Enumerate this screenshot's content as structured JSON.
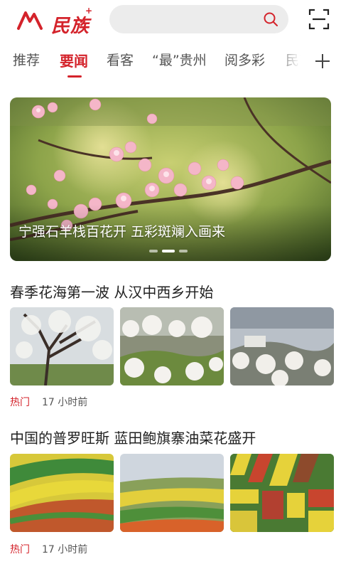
{
  "header": {
    "logo_text": "民族",
    "logo_plus": "+",
    "search": {
      "placeholder": ""
    }
  },
  "tabs": [
    {
      "label": "推荐",
      "active": false
    },
    {
      "label": "要闻",
      "active": true
    },
    {
      "label": "看客",
      "active": false
    },
    {
      "label": "“最”贵州",
      "active": false
    },
    {
      "label": "阅多彩",
      "active": false
    },
    {
      "label": "民族",
      "active": false
    }
  ],
  "banner": {
    "caption": "宁强石羊栈百花开 五彩斑斓入画来",
    "slide_count": 3,
    "active_slide": 2
  },
  "articles": [
    {
      "title": "春季花海第一波 从汉中西乡开始",
      "tag": "热门",
      "time": "17 小时前",
      "thumbnails": [
        "blossom-tree-photo",
        "white-blossom-valley-photo",
        "blossom-village-photo"
      ]
    },
    {
      "title": "中国的普罗旺斯 蓝田鲍旗寨油菜花盛开",
      "tag": "热门",
      "time": "17 小时前",
      "thumbnails": [
        "rapeseed-fields-photo",
        "terraced-fields-photo",
        "aerial-fields-photo"
      ]
    }
  ],
  "colors": {
    "accent": "#d4232b",
    "search_bg": "#ececec"
  }
}
